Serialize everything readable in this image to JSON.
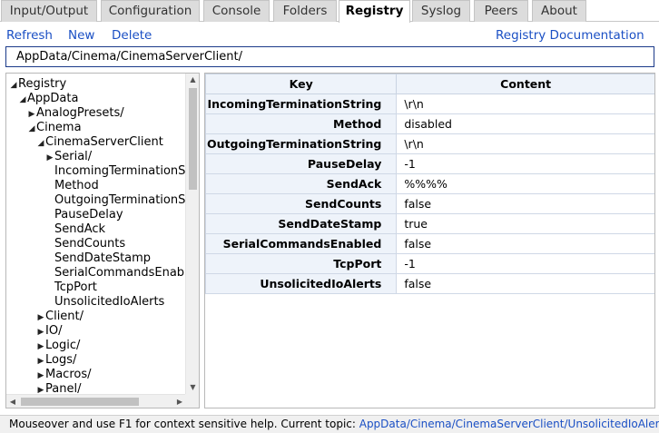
{
  "tabs": [
    {
      "label": "Input/Output"
    },
    {
      "label": "Configuration"
    },
    {
      "label": "Console"
    },
    {
      "label": "Folders"
    },
    {
      "label": "Registry",
      "active": true
    },
    {
      "label": "Syslog"
    },
    {
      "label": "Peers"
    },
    {
      "label": "About"
    }
  ],
  "actions": {
    "refresh": "Refresh",
    "new": "New",
    "delete": "Delete",
    "documentation": "Registry Documentation"
  },
  "path": "AppData/Cinema/CinemaServerClient/",
  "tree": [
    {
      "label": "Registry",
      "twisty": "◢"
    },
    {
      "label": "AppData",
      "twisty": "◢"
    },
    {
      "label": "AnalogPresets/",
      "twisty": "▶"
    },
    {
      "label": "Cinema",
      "twisty": "◢"
    },
    {
      "label": "CinemaServerClient",
      "twisty": "◢"
    },
    {
      "label": "Serial/",
      "twisty": "▶"
    },
    {
      "label": "IncomingTerminationS",
      "twisty": ""
    },
    {
      "label": "Method",
      "twisty": ""
    },
    {
      "label": "OutgoingTerminationS",
      "twisty": ""
    },
    {
      "label": "PauseDelay",
      "twisty": ""
    },
    {
      "label": "SendAck",
      "twisty": ""
    },
    {
      "label": "SendCounts",
      "twisty": ""
    },
    {
      "label": "SendDateStamp",
      "twisty": ""
    },
    {
      "label": "SerialCommandsEnab",
      "twisty": ""
    },
    {
      "label": "TcpPort",
      "twisty": ""
    },
    {
      "label": "UnsolicitedIoAlerts",
      "twisty": ""
    },
    {
      "label": "Client/",
      "twisty": "▶"
    },
    {
      "label": "IO/",
      "twisty": "▶"
    },
    {
      "label": "Logic/",
      "twisty": "▶"
    },
    {
      "label": "Logs/",
      "twisty": "▶"
    },
    {
      "label": "Macros/",
      "twisty": "▶"
    },
    {
      "label": "Panel/",
      "twisty": "▶"
    }
  ],
  "table": {
    "headers": {
      "key": "Key",
      "content": "Content"
    },
    "rows": [
      {
        "key": "IncomingTerminationString",
        "content": "\\r\\n"
      },
      {
        "key": "Method",
        "content": "disabled"
      },
      {
        "key": "OutgoingTerminationString",
        "content": "\\r\\n"
      },
      {
        "key": "PauseDelay",
        "content": "-1"
      },
      {
        "key": "SendAck",
        "content": "%%%%"
      },
      {
        "key": "SendCounts",
        "content": "false"
      },
      {
        "key": "SendDateStamp",
        "content": "true"
      },
      {
        "key": "SerialCommandsEnabled",
        "content": "false"
      },
      {
        "key": "TcpPort",
        "content": "-1"
      },
      {
        "key": "UnsolicitedIoAlerts",
        "content": "false"
      }
    ]
  },
  "status": {
    "text": "Mouseover and use F1 for context sensitive help. Current topic: ",
    "topic": "AppData/Cinema/CinemaServerClient/UnsolicitedIoAlerts"
  },
  "icons": {
    "scroll_up": "▲",
    "scroll_down": "▼",
    "scroll_left": "◀",
    "scroll_right": "▶"
  }
}
